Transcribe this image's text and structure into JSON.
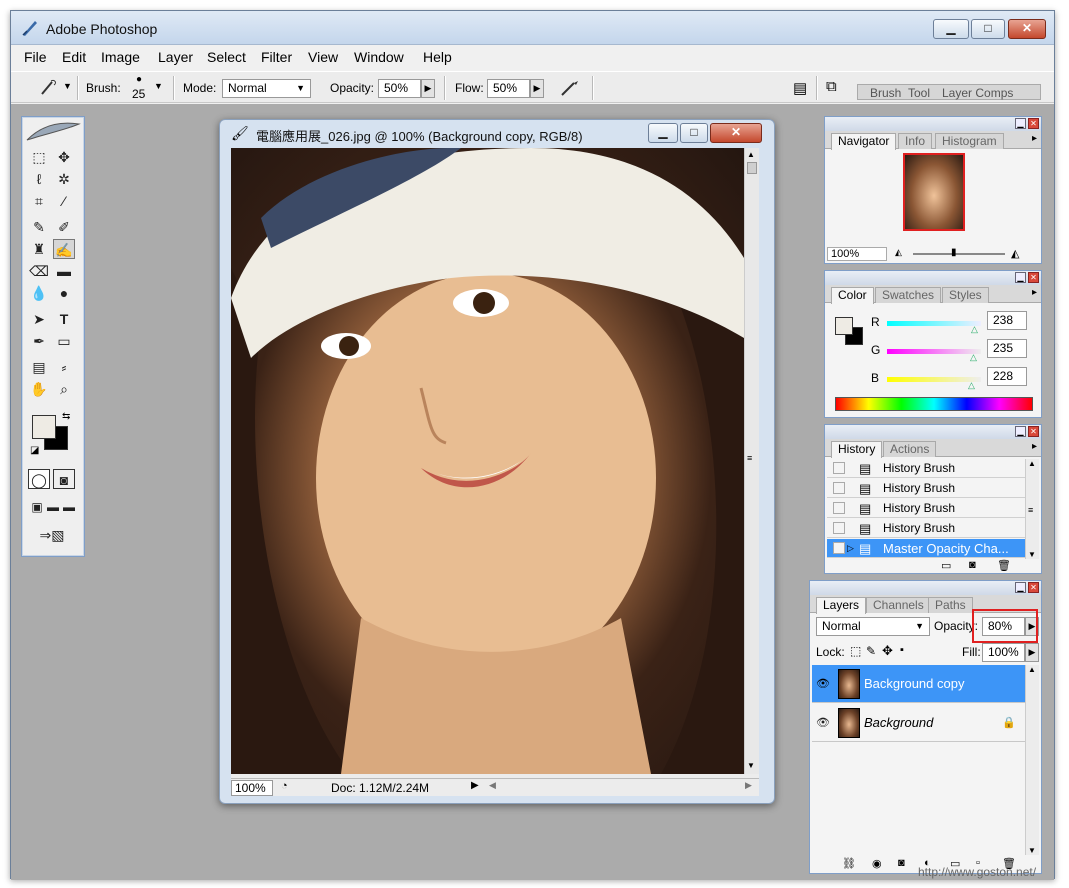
{
  "app": {
    "title": "Adobe Photoshop",
    "minimize": "▁",
    "maximize": "□",
    "close": "✕"
  },
  "menu": [
    "File",
    "Edit",
    "Image",
    "Layer",
    "Select",
    "Filter",
    "View",
    "Window",
    "Help"
  ],
  "options_bar": {
    "brush_label": "Brush:",
    "brush_size": "25",
    "mode_label": "Mode:",
    "mode_value": "Normal",
    "opacity_label": "Opacity:",
    "opacity_value": "50%",
    "flow_label": "Flow:",
    "flow_value": "50%",
    "well_tabs": [
      "Brush",
      "Tool",
      "Layer Comps"
    ]
  },
  "document": {
    "title": "電腦應用展_026.jpg @ 100% (Background copy, RGB/8)",
    "zoom": "100%",
    "doc_size": "Doc: 1.12M/2.24M"
  },
  "navigator": {
    "tabs": [
      "Navigator",
      "Info",
      "Histogram"
    ],
    "zoom": "100%"
  },
  "color": {
    "tabs": [
      "Color",
      "Swatches",
      "Styles"
    ],
    "r_label": "R",
    "r_value": "238",
    "g_label": "G",
    "g_value": "235",
    "b_label": "B",
    "b_value": "228",
    "foreground": "#eeebe4",
    "background": "#000000"
  },
  "history": {
    "tabs": [
      "History",
      "Actions"
    ],
    "items": [
      "History Brush",
      "History Brush",
      "History Brush",
      "History Brush",
      "Master Opacity Cha..."
    ],
    "selected_index": 4
  },
  "layers": {
    "tabs": [
      "Layers",
      "Channels",
      "Paths"
    ],
    "blend_mode": "Normal",
    "opacity_label": "Opacity:",
    "opacity_value": "80%",
    "lock_label": "Lock:",
    "fill_label": "Fill:",
    "fill_value": "100%",
    "items": [
      "Background copy",
      "Background"
    ],
    "selected_index": 0
  },
  "watermark": "http://www.goston.net/",
  "colors": {
    "selection": "#3d95f7",
    "highlight_box": "#e02020"
  }
}
